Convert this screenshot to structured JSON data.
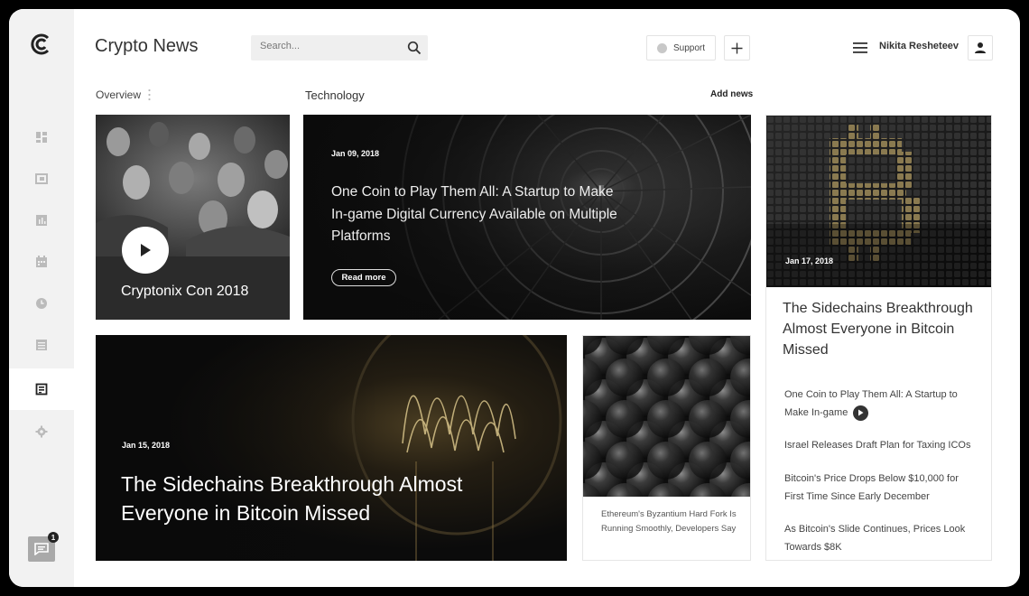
{
  "header": {
    "app_title": "Crypto News",
    "search_placeholder": "Search...",
    "support_label": "Support",
    "user_name": "Nikita Resheteev"
  },
  "sidebar": {
    "items": [
      {
        "icon": "dashboard-icon",
        "active": false
      },
      {
        "icon": "cards-icon",
        "active": false
      },
      {
        "icon": "chart-icon",
        "active": false
      },
      {
        "icon": "calendar-icon",
        "active": false
      },
      {
        "icon": "clock-icon",
        "active": false
      },
      {
        "icon": "table-icon",
        "active": false
      },
      {
        "icon": "news-icon",
        "active": true
      },
      {
        "icon": "settings-icon",
        "active": false
      }
    ],
    "chat_badge": "1"
  },
  "subheader": {
    "overview_label": "Overview",
    "section_title": "Technology",
    "add_news_label": "Add news"
  },
  "cards": {
    "video": {
      "title": "Cryptonix Con 2018"
    },
    "featured": {
      "date": "Jan 09, 2018",
      "title": "One Coin to Play Them All: A Startup to Make In-game Digital Currency Available on Multiple Platforms",
      "read_more": "Read more"
    },
    "sidebar_article": {
      "date": "Jan 17, 2018",
      "title": "The Sidechains Breakthrough Almost Everyone in Bitcoin Missed",
      "related": [
        "One Coin to Play Them All: A Startup to Make In-game",
        "Israel Releases Draft Plan for Taxing ICOs",
        "Bitcoin's Price Drops Below $10,000 for First Time Since Early December",
        "As Bitcoin's Slide Continues, Prices Look Towards $8K"
      ]
    },
    "bulb": {
      "date": "Jan 15, 2018",
      "title": "The Sidechains Breakthrough Almost Everyone in Bitcoin Missed"
    },
    "sphere": {
      "caption": "Ethereum's Byzantium Hard Fork Is Running Smoothly, Developers Say"
    }
  },
  "colors": {
    "sidebar_bg": "#f2f2f2",
    "active_item_bg": "#ffffff",
    "text_primary": "#333333"
  }
}
